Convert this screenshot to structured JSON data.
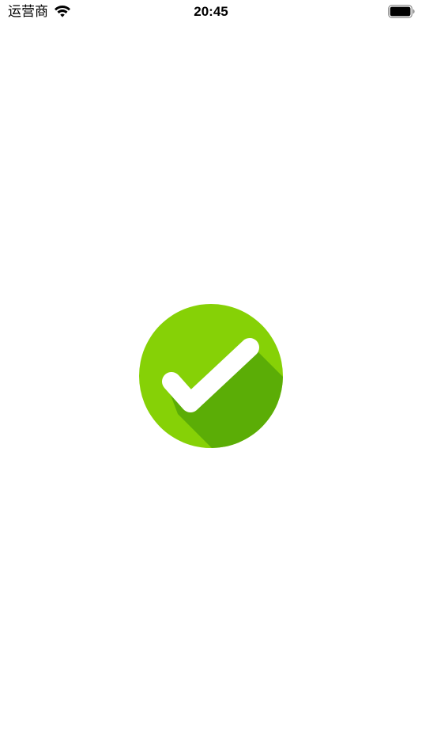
{
  "status_bar": {
    "carrier": "运营商",
    "time": "20:45",
    "wifi_icon": "wifi-icon",
    "battery_icon": "battery-full-icon"
  },
  "main": {
    "icon": "check-circle-icon",
    "colors": {
      "circle": "#86D106",
      "shadow": "#5BAD06",
      "check": "#FFFFFF"
    }
  }
}
